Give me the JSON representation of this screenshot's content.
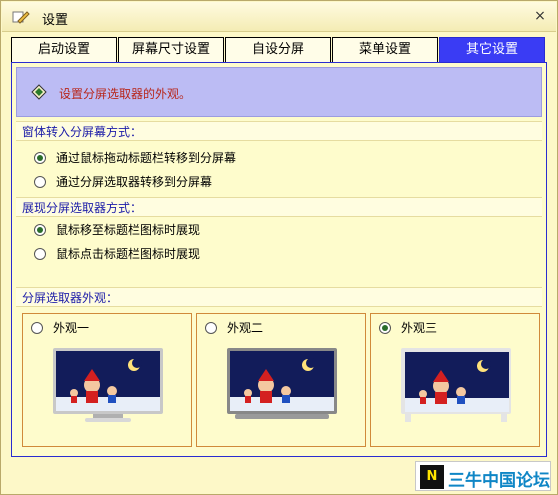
{
  "window": {
    "title": "设置",
    "close_glyph": "×"
  },
  "tabs": [
    {
      "label": "启动设置"
    },
    {
      "label": "屏幕尺寸设置"
    },
    {
      "label": "自设分屏"
    },
    {
      "label": "菜单设置"
    },
    {
      "label": "其它设置"
    }
  ],
  "active_tab": "其它设置",
  "header": {
    "text": "设置分屏选取器的外观。"
  },
  "section_move": {
    "label": "窗体转入分屏幕方式：",
    "options": [
      {
        "label": "通过鼠标拖动标题栏转移到分屏幕",
        "checked": true
      },
      {
        "label": "通过分屏选取器转移到分屏幕",
        "checked": false
      }
    ]
  },
  "section_show": {
    "label": "展现分屏选取器方式：",
    "options": [
      {
        "label": "鼠标移至标题栏图标时展现",
        "checked": true
      },
      {
        "label": "鼠标点击标题栏图标时展现",
        "checked": false
      }
    ]
  },
  "section_appearance": {
    "label": "分屏选取器外观：",
    "options": [
      {
        "label": "外观一",
        "checked": false
      },
      {
        "label": "外观二",
        "checked": false
      },
      {
        "label": "外观三",
        "checked": true
      }
    ]
  },
  "logo": {
    "mark": "N",
    "text": "三牛中国论坛"
  },
  "colors": {
    "accent": "#3a3cf4",
    "header_band": "#bcbcf4",
    "header_text": "#b8261a",
    "section_label": "#1c1ca8",
    "panel_bg": "#fefccc",
    "option_border": "#d08a3a"
  },
  "icons": {
    "title": "pencil-settings-icon",
    "header": "info-diamond-icon",
    "close": "close-icon"
  }
}
